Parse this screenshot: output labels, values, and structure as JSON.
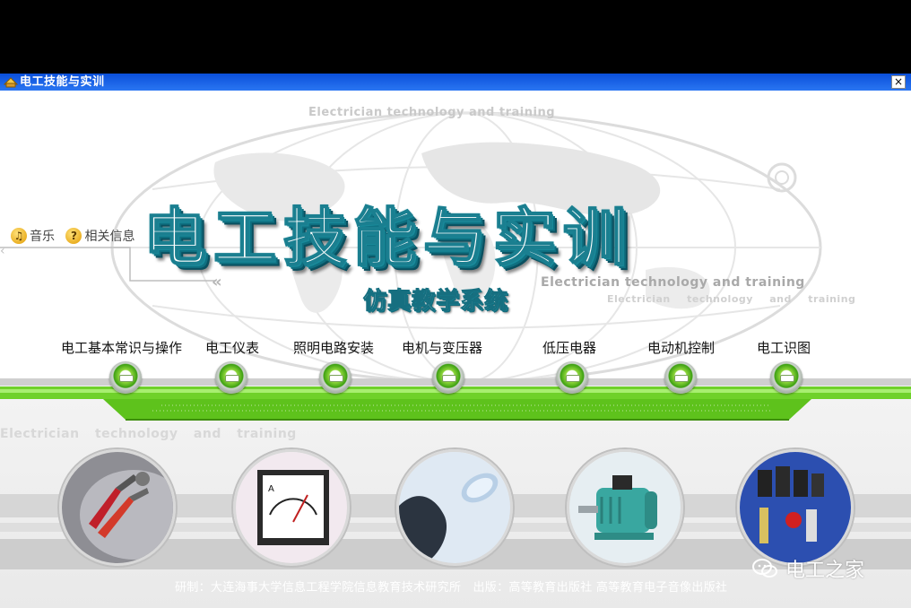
{
  "window": {
    "title": "电工技能与实训",
    "close_label": "×"
  },
  "decor_text": {
    "eng_top": "Electrician technology and training",
    "eng_right": "Electrician technology and training",
    "eng_right_small": "Electrician technology and training",
    "eng_left": "Electrician technology and training"
  },
  "main_title": "电工技能与实训",
  "subtitle": "仿真教学系统",
  "side_buttons": [
    {
      "label": "音乐",
      "icon": "music-icon"
    },
    {
      "label": "相关信息",
      "icon": "help-icon"
    }
  ],
  "menu": [
    {
      "label": "电工基本常识与操作"
    },
    {
      "label": "电工仪表"
    },
    {
      "label": "照明电路安装"
    },
    {
      "label": "电机与变压器"
    },
    {
      "label": "低压电器"
    },
    {
      "label": "电动机控制"
    },
    {
      "label": "电工识图"
    }
  ],
  "photos": [
    {
      "name": "pliers-tools-photo"
    },
    {
      "name": "ammeter-photo"
    },
    {
      "name": "face-lightbulb-photo"
    },
    {
      "name": "motor-photo"
    },
    {
      "name": "low-voltage-components-photo"
    }
  ],
  "footer": "研制：大连海事大学信息工程学院信息教育技术研究所　出版：高等教育出版社  高等教育电子音像出版社",
  "watermark": "电工之家",
  "colors": {
    "titlebar": "#0a4fd9",
    "accent_green": "#5cc41f",
    "title_teal": "#1a7f90"
  }
}
